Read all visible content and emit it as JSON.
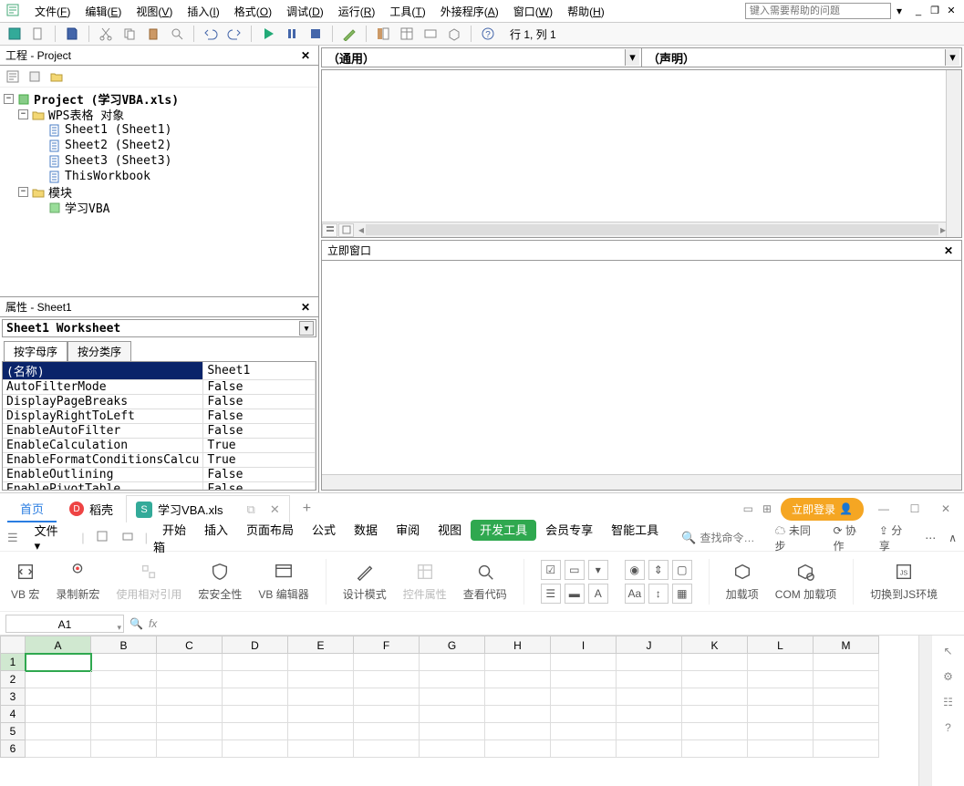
{
  "vba": {
    "menus": [
      {
        "label": "文件",
        "key": "F"
      },
      {
        "label": "编辑",
        "key": "E"
      },
      {
        "label": "视图",
        "key": "V"
      },
      {
        "label": "插入",
        "key": "I"
      },
      {
        "label": "格式",
        "key": "O"
      },
      {
        "label": "调试",
        "key": "D"
      },
      {
        "label": "运行",
        "key": "R"
      },
      {
        "label": "工具",
        "key": "T"
      },
      {
        "label": "外接程序",
        "key": "A"
      },
      {
        "label": "窗口",
        "key": "W"
      },
      {
        "label": "帮助",
        "key": "H"
      }
    ],
    "help_placeholder": "键入需要帮助的问题",
    "cursor_info": "行 1, 列 1",
    "project_panel_title": "工程 - Project",
    "tree": {
      "root": "Project (学习VBA.xls)",
      "group1": "WPS表格 对象",
      "sheets": [
        "Sheet1 (Sheet1)",
        "Sheet2 (Sheet2)",
        "Sheet3 (Sheet3)",
        "ThisWorkbook"
      ],
      "group2": "模块",
      "modules": [
        "学习VBA"
      ]
    },
    "props_panel_title": "属性 - Sheet1",
    "props_object": "Sheet1 Worksheet",
    "props_tabs": [
      "按字母序",
      "按分类序"
    ],
    "properties": [
      {
        "name": "(名称)",
        "value": "Sheet1",
        "selected": true
      },
      {
        "name": "AutoFilterMode",
        "value": "False"
      },
      {
        "name": "DisplayPageBreaks",
        "value": "False"
      },
      {
        "name": "DisplayRightToLeft",
        "value": "False"
      },
      {
        "name": "EnableAutoFilter",
        "value": "False"
      },
      {
        "name": "EnableCalculation",
        "value": "True"
      },
      {
        "name": "EnableFormatConditionsCalcu",
        "value": "True"
      },
      {
        "name": "EnableOutlining",
        "value": "False"
      },
      {
        "name": "EnablePivotTable",
        "value": "False"
      }
    ],
    "code_combo_left": "（通用）",
    "code_combo_right": "（声明）",
    "immediate_title": "立即窗口"
  },
  "wps": {
    "tabs": {
      "home": "首页",
      "dao": "稻壳",
      "doc": "学习VBA.xls"
    },
    "login": "立即登录",
    "file_menu": "文件",
    "ribbon_tabs": [
      "开始",
      "插入",
      "页面布局",
      "公式",
      "数据",
      "审阅",
      "视图",
      "开发工具",
      "会员专享",
      "智能工具箱"
    ],
    "active_ribbon_tab": "开发工具",
    "search_placeholder": "查找命令…",
    "right_actions": [
      "未同步",
      "协作",
      "分享"
    ],
    "ribbon_buttons": {
      "vb_macro": "VB 宏",
      "record_macro": "录制新宏",
      "relative_ref": "使用相对引用",
      "macro_security": "宏安全性",
      "vb_editor": "VB 编辑器",
      "design_mode": "设计模式",
      "ctrl_props": "控件属性",
      "view_code": "查看代码",
      "addins": "加载项",
      "com_addins": "COM 加载项",
      "switch_js": "切换到JS环境"
    },
    "name_box": "A1",
    "columns": [
      "A",
      "B",
      "C",
      "D",
      "E",
      "F",
      "G",
      "H",
      "I",
      "J",
      "K",
      "L",
      "M"
    ],
    "rows": [
      "1",
      "2",
      "3",
      "4",
      "5",
      "6"
    ],
    "active_cell": {
      "row": 0,
      "col": 0
    }
  }
}
